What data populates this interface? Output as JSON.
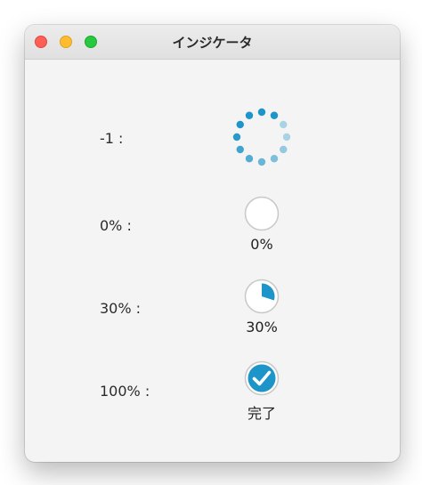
{
  "window": {
    "title": "インジケータ"
  },
  "colors": {
    "accent": "#1e95c8",
    "ring": "#c8c8c8"
  },
  "rows": [
    {
      "label": "-1 :",
      "progress": -1,
      "caption": ""
    },
    {
      "label": "0% :",
      "progress": 0,
      "caption": "0%"
    },
    {
      "label": "30% :",
      "progress": 0.3,
      "caption": "30%"
    },
    {
      "label": "100% :",
      "progress": 1.0,
      "caption": "完了"
    }
  ]
}
